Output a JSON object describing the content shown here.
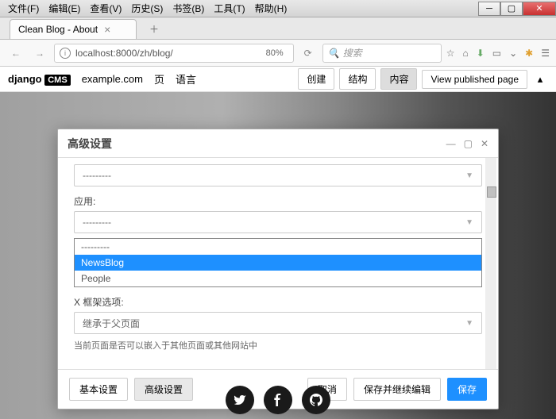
{
  "menubar": [
    "文件(F)",
    "编辑(E)",
    "查看(V)",
    "历史(S)",
    "书签(B)",
    "工具(T)",
    "帮助(H)"
  ],
  "tab": {
    "title": "Clean Blog - About"
  },
  "address": {
    "url": "localhost:8000/zh/blog/",
    "zoom": "80%",
    "search_placeholder": "搜索"
  },
  "cms": {
    "brand": "django",
    "brand_tag": "CMS",
    "site": "example.com",
    "menu_page": "页",
    "menu_lang": "语言",
    "create": "创建",
    "structure": "结构",
    "content": "内容",
    "view_published": "View published page"
  },
  "modal": {
    "title": "高级设置",
    "select_dashes": "---------",
    "label_app": "应用:",
    "dropdown": [
      "---------",
      "NewsBlog",
      "People"
    ],
    "xframe_label": "X 框架选项:",
    "xframe_value": "继承于父页面",
    "help": "当前页面是否可以嵌入于其他页面或其他网站中",
    "basic": "基本设置",
    "advanced": "高级设置",
    "cancel": "取消",
    "save_continue": "保存并继续编辑",
    "save": "保存"
  }
}
